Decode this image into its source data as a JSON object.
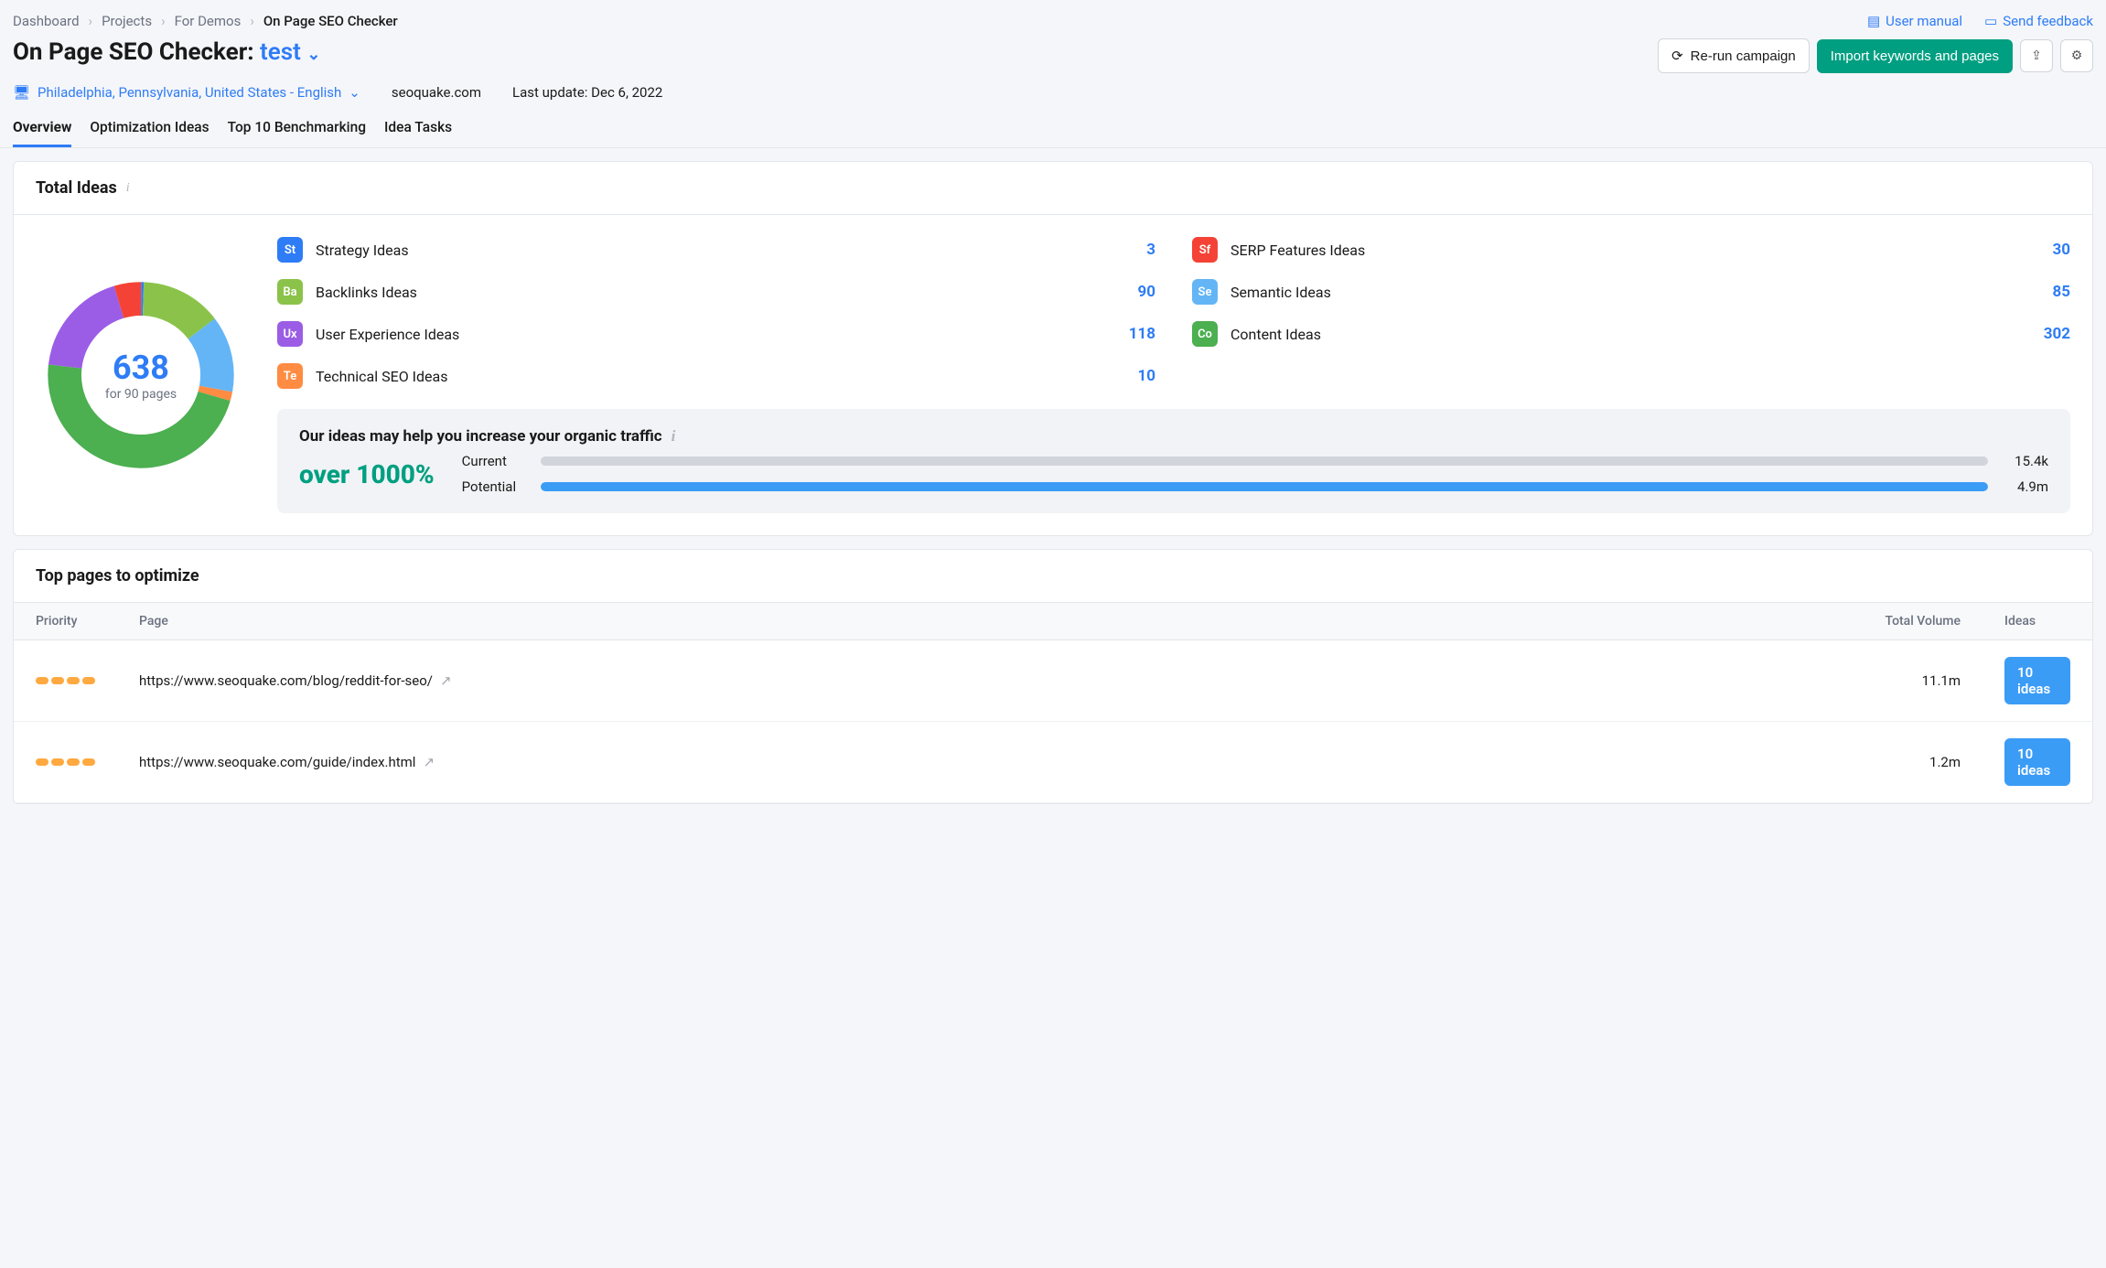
{
  "breadcrumb": {
    "items": [
      "Dashboard",
      "Projects",
      "For Demos",
      "On Page SEO Checker"
    ]
  },
  "toplinks": {
    "manual": "User manual",
    "feedback": "Send feedback"
  },
  "header": {
    "title_prefix": "On Page SEO Checker: ",
    "title_project": "test",
    "rerun": "Re-run campaign",
    "import": "Import keywords and pages"
  },
  "subheader": {
    "location": "Philadelphia, Pennsylvania, United States - English",
    "domain": "seoquake.com",
    "last_update": "Last update: Dec 6, 2022"
  },
  "tabs": [
    "Overview",
    "Optimization Ideas",
    "Top 10 Benchmarking",
    "Idea Tasks"
  ],
  "total_ideas": {
    "title": "Total Ideas",
    "center_value": "638",
    "center_sub": "for 90 pages"
  },
  "chart_data": {
    "type": "pie",
    "title": "Total Ideas",
    "total": 638,
    "series": [
      {
        "code": "St",
        "name": "Strategy Ideas",
        "value": 3,
        "color": "#2e7cf6"
      },
      {
        "code": "Ba",
        "name": "Backlinks Ideas",
        "value": 90,
        "color": "#8bc34a"
      },
      {
        "code": "Ux",
        "name": "User Experience Ideas",
        "value": 118,
        "color": "#9b5de5"
      },
      {
        "code": "Te",
        "name": "Technical SEO Ideas",
        "value": 10,
        "color": "#ff8c42"
      },
      {
        "code": "Sf",
        "name": "SERP Features Ideas",
        "value": 30,
        "color": "#f44336"
      },
      {
        "code": "Se",
        "name": "Semantic Ideas",
        "value": 85,
        "color": "#64b5f6"
      },
      {
        "code": "Co",
        "name": "Content Ideas",
        "value": 302,
        "color": "#4caf50"
      }
    ]
  },
  "traffic": {
    "title": "Our ideas may help you increase your organic traffic",
    "pct": "over 1000%",
    "current_label": "Current",
    "current_value": "15.4k",
    "current_fill": 2,
    "potential_label": "Potential",
    "potential_value": "4.9m",
    "potential_fill": 100
  },
  "top_pages": {
    "title": "Top pages to optimize",
    "columns": {
      "priority": "Priority",
      "page": "Page",
      "volume": "Total Volume",
      "ideas": "Ideas"
    },
    "rows": [
      {
        "page": "https://www.seoquake.com/blog/reddit-for-seo/",
        "volume": "11.1m",
        "ideas": "10 ideas"
      },
      {
        "page": "https://www.seoquake.com/guide/index.html",
        "volume": "1.2m",
        "ideas": "10 ideas"
      }
    ]
  }
}
